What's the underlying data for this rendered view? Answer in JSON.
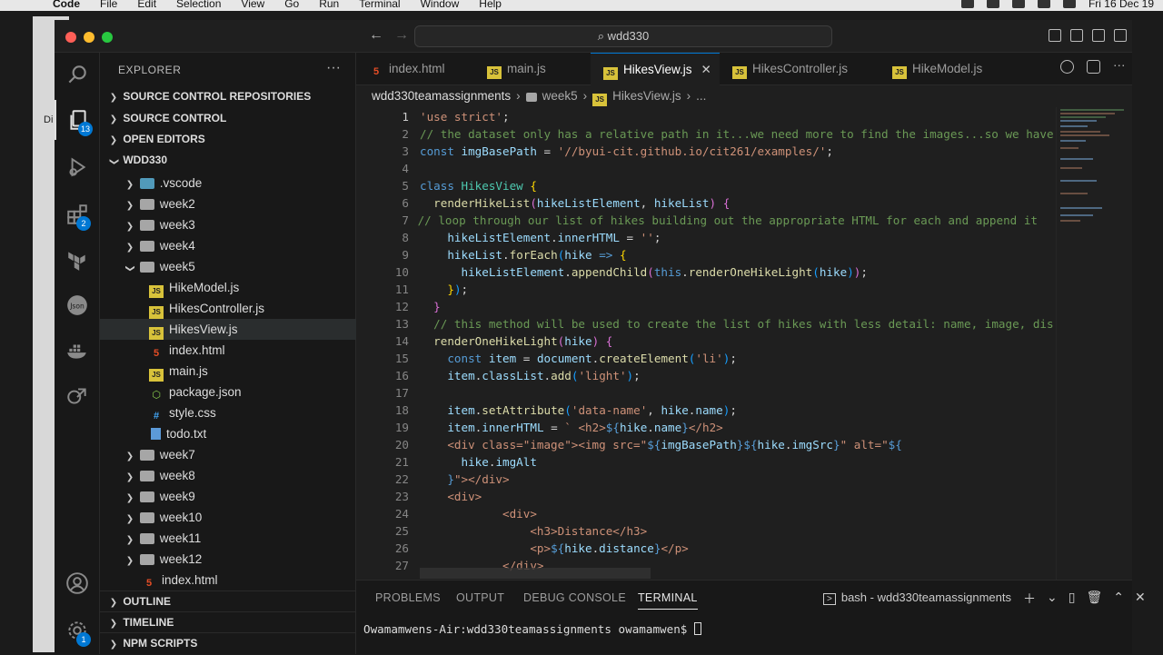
{
  "menubar": {
    "app": "Code",
    "items": [
      "File",
      "Edit",
      "Selection",
      "View",
      "Go",
      "Run",
      "Terminal",
      "Window",
      "Help"
    ],
    "clock": "Fri 16 Dec  19"
  },
  "background_window_text": "Di",
  "titlebar": {
    "search": "wdd330"
  },
  "activity": {
    "source_control_badge": "13",
    "extensions_badge": "2",
    "accounts_badge": "1"
  },
  "sidebar": {
    "title": "EXPLORER",
    "sections": {
      "scr": "SOURCE CONTROL REPOSITORIES",
      "sc": "SOURCE CONTROL",
      "open": "OPEN EDITORS",
      "root": "WDD330",
      "outline": "OUTLINE",
      "timeline": "TIMELINE",
      "npm": "NPM SCRIPTS"
    },
    "tree": [
      ".vscode",
      "week2",
      "week3",
      "week4",
      "week5",
      "HikeModel.js",
      "HikesController.js",
      "HikesView.js",
      "index.html",
      "main.js",
      "package.json",
      "style.css",
      "todo.txt",
      "week7",
      "week8",
      "week9",
      "week10",
      "week11",
      "week12",
      "index.html"
    ]
  },
  "tabs": [
    "index.html",
    "main.js",
    "HikesView.js",
    "HikesController.js",
    "HikeModel.js"
  ],
  "breadcrumbs": [
    "wdd330teamassignments",
    "week5",
    "HikesView.js",
    "..."
  ],
  "editor": {
    "line_numbers": [
      "1",
      "2",
      "3",
      "4",
      "5",
      "6",
      "7",
      "8",
      "9",
      "10",
      "11",
      "12",
      "13",
      "14",
      "15",
      "16",
      "17",
      "18",
      "19",
      "20",
      "21",
      "22",
      "23",
      "24",
      "25",
      "26",
      "27"
    ],
    "comment_2": "// the dataset only has a relative path in it...we need more to find the images...so we have",
    "comment_7": "// loop through our list of hikes building out the appropriate HTML for each and append it",
    "comment_13": "// this method will be used to create the list of hikes with less detail: name, image, dis"
  },
  "panel": {
    "tabs": [
      "PROBLEMS",
      "OUTPUT",
      "DEBUG CONSOLE",
      "TERMINAL"
    ],
    "terminal_name": "bash - wdd330teamassignments",
    "prompt": "Owamamwens-Air:wdd330teamassignments owamamwen$ "
  }
}
